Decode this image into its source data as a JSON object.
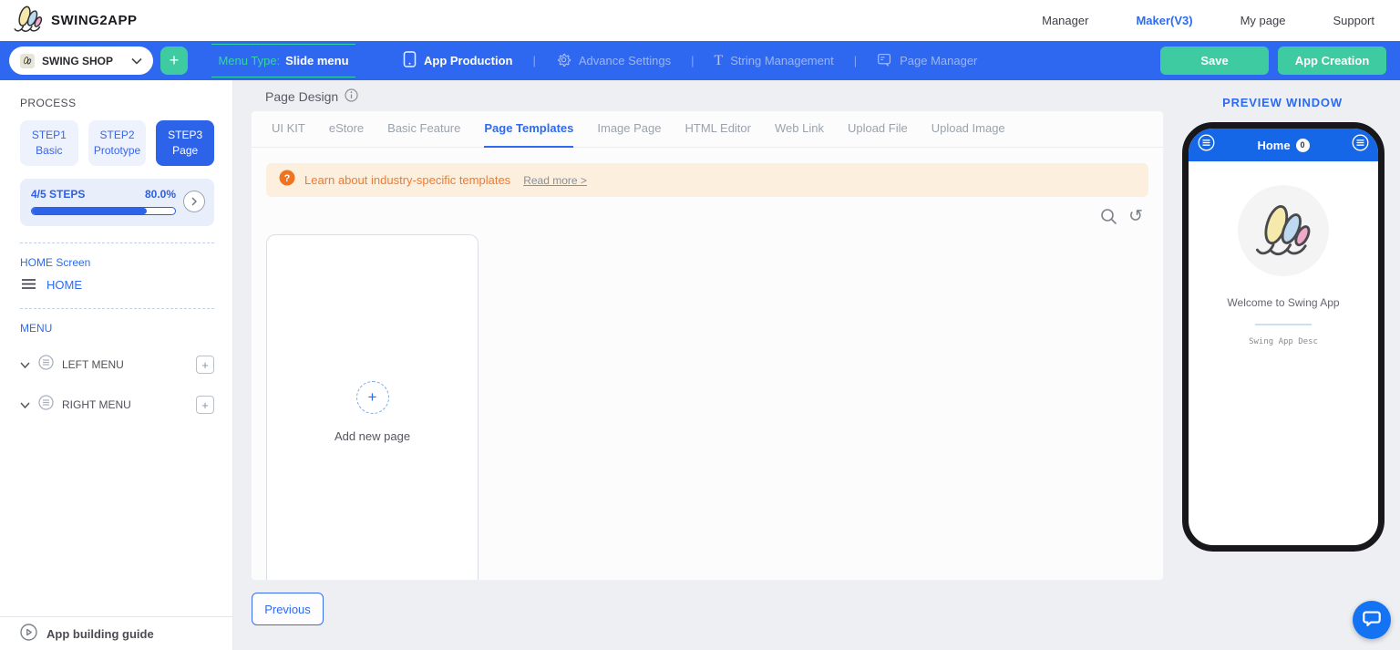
{
  "header": {
    "brand": "SWING2APP",
    "nav": [
      {
        "label": "Manager"
      },
      {
        "label": "Maker(V3)"
      },
      {
        "label": "My page"
      },
      {
        "label": "Support"
      }
    ]
  },
  "toolbar": {
    "app_selector_value": "SWING SHOP",
    "add_app_label": "+",
    "menu_type_label": "Menu Type:",
    "menu_type_value": "Slide menu",
    "items": [
      {
        "label": "App Production",
        "icon": "phone-icon"
      },
      {
        "label": "Advance Settings",
        "icon": "gear-icon"
      },
      {
        "label": "String Management",
        "icon": "text-icon"
      },
      {
        "label": "Page Manager",
        "icon": "document-icon"
      }
    ],
    "save_label": "Save",
    "app_creation_label": "App Creation"
  },
  "sidebar": {
    "process_label": "PROCESS",
    "steps": [
      {
        "step": "STEP1",
        "name": "Basic"
      },
      {
        "step": "STEP2",
        "name": "Prototype"
      },
      {
        "step": "STEP3",
        "name": "Page"
      }
    ],
    "progress": {
      "label": "4/5 STEPS",
      "percent": "80.0%",
      "value": 80
    },
    "home_screen_label": "HOME Screen",
    "home_label": "HOME",
    "menu_label": "MENU",
    "menus": [
      {
        "label": "LEFT MENU"
      },
      {
        "label": "RIGHT MENU"
      }
    ],
    "guide_label": "App building guide"
  },
  "main": {
    "title": "Page Design",
    "tabs": [
      "UI KIT",
      "eStore",
      "Basic Feature",
      "Page Templates",
      "Image Page",
      "HTML Editor",
      "Web Link",
      "Upload File",
      "Upload Image"
    ],
    "active_tab": "Page Templates",
    "banner": {
      "text": "Learn about industry-specific templates",
      "link": "Read more >"
    },
    "add_card_label": "Add new page",
    "previous_label": "Previous"
  },
  "preview": {
    "title": "PREVIEW WINDOW",
    "phone": {
      "header_title": "Home",
      "badge_count": "0",
      "welcome_text": "Welcome to Swing App",
      "desc_text": "Swing App Desc"
    }
  },
  "colors": {
    "toolbar_blue": "#2f68f0",
    "accent_blue": "#2d6af0",
    "teal": "#3ecba2",
    "banner_bg": "#fcefdd",
    "banner_orange": "#ee7a33"
  }
}
